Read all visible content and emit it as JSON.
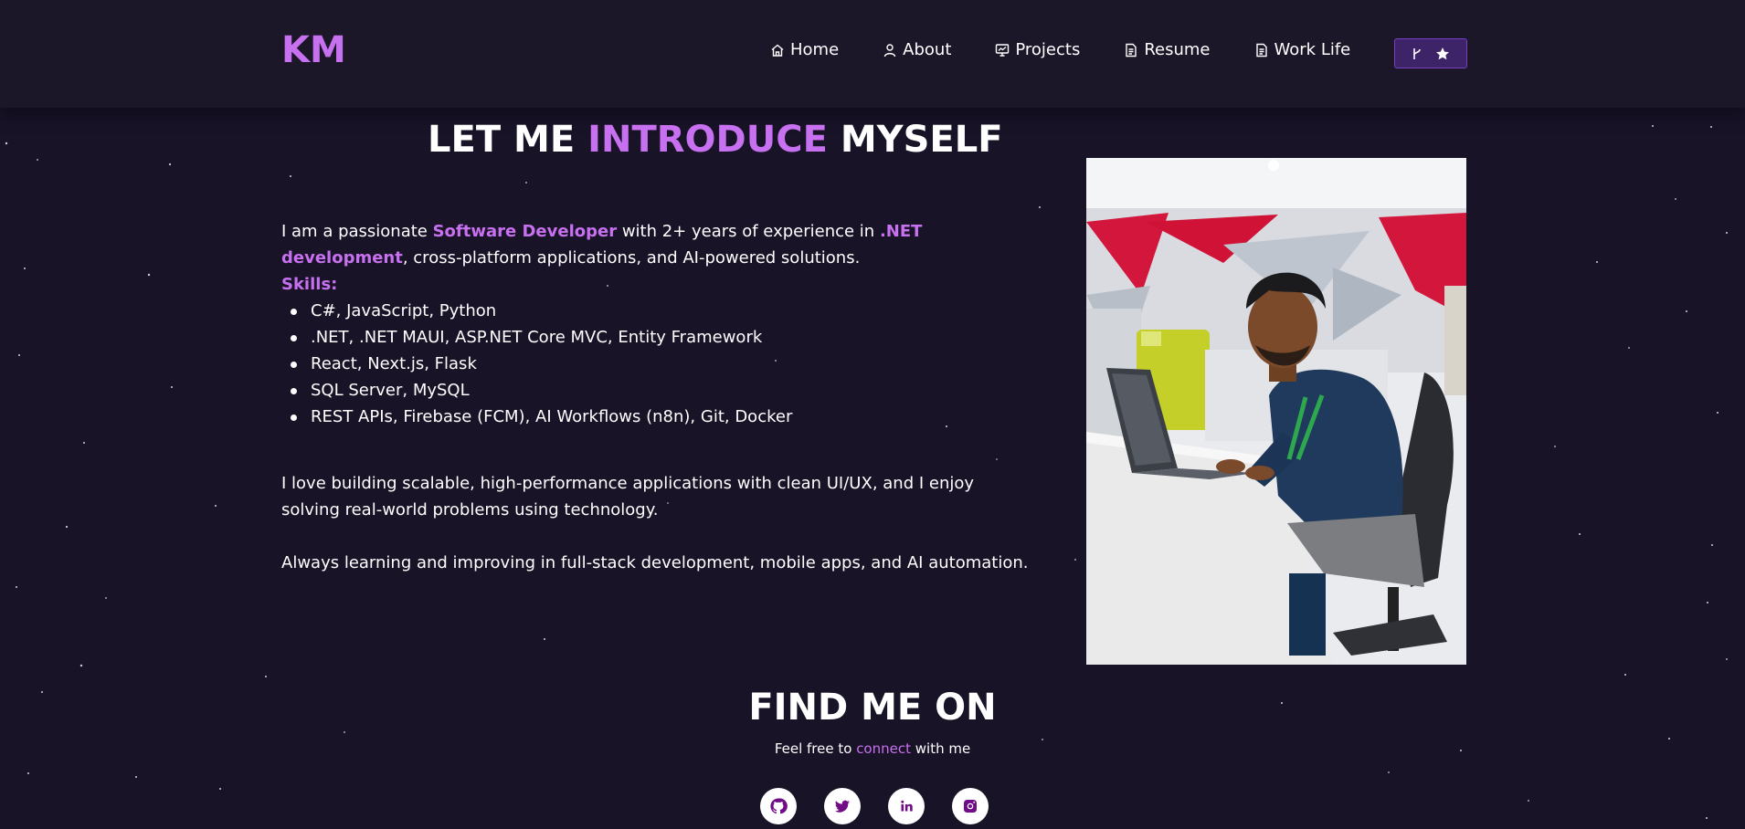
{
  "nav": {
    "logo": "KM",
    "items": [
      {
        "label": "Home",
        "icon": "home-icon"
      },
      {
        "label": "About",
        "icon": "user-icon"
      },
      {
        "label": "Projects",
        "icon": "projects-icon"
      },
      {
        "label": "Resume",
        "icon": "document-icon"
      },
      {
        "label": "Work Life",
        "icon": "document-icon"
      }
    ],
    "fork_button": {
      "icons": [
        "git-branch-icon",
        "star-icon"
      ]
    }
  },
  "about": {
    "heading_pre": "LET ME ",
    "heading_accent": "INTRODUCE",
    "heading_post": " MYSELF",
    "intro_1": "I am a passionate ",
    "intro_accent_1": "Software Developer",
    "intro_2": " with 2+ years of experience in ",
    "intro_accent_2": ".NET development",
    "intro_3": ", cross-platform applications, and AI-powered solutions.",
    "skills_title": "Skills:",
    "skills": [
      "C#, JavaScript, Python",
      ".NET, .NET MAUI, ASP.NET Core MVC, Entity Framework",
      "React, Next.js, Flask",
      "SQL Server, MySQL",
      "REST APIs, Firebase (FCM), AI Workflows (n8n), Git, Docker"
    ],
    "paragraph_2": "I love building scalable, high-performance applications with clean UI/UX, and I enjoy solving real-world problems using technology.",
    "paragraph_3": "Always learning and improving in full-stack development, mobile apps, and AI automation."
  },
  "find": {
    "heading": "FIND ME ON",
    "sub_pre": "Feel free to ",
    "sub_accent": "connect",
    "sub_post": " with me",
    "socials": [
      "github-icon",
      "twitter-icon",
      "linkedin-icon",
      "instagram-icon"
    ]
  },
  "colors": {
    "background": "#181327",
    "navbar": "#1b1729",
    "accent": "#c770f0",
    "button": "#3d2468",
    "social_icon": "#700c86"
  }
}
